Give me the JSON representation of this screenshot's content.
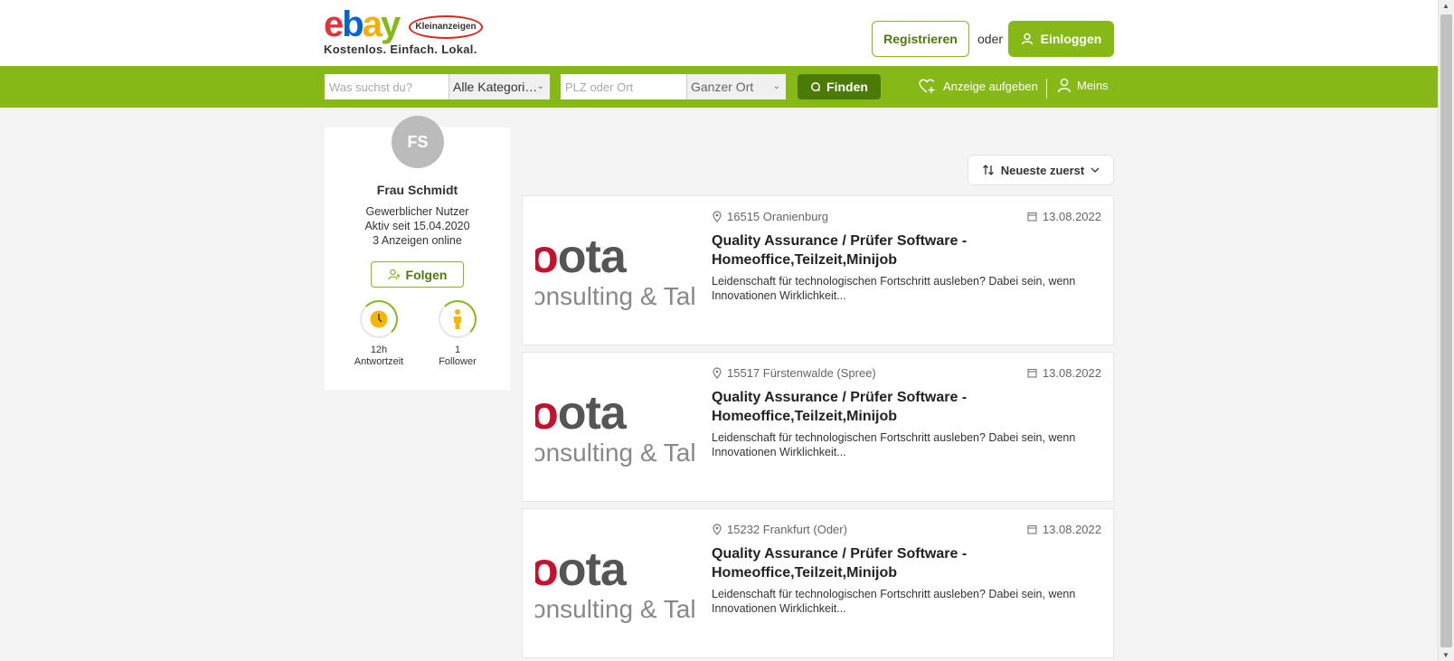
{
  "header": {
    "logo_ebay": "ebay",
    "logo_badge": "Kleinanzeigen",
    "tagline": "Kostenlos. Einfach. Lokal.",
    "register_label": "Registrieren",
    "or_label": "oder",
    "login_label": "Einloggen"
  },
  "search": {
    "query_placeholder": "Was suchst du?",
    "category_value": "Alle Kategori…",
    "location_placeholder": "PLZ oder Ort",
    "radius_value": "Ganzer Ort",
    "find_label": "Finden",
    "post_ad_label": "Anzeige aufgeben",
    "meins_label": "Meins"
  },
  "profile": {
    "initials": "FS",
    "name": "Frau Schmidt",
    "user_type": "Gewerblicher Nutzer",
    "active_since": "Aktiv seit 15.04.2020",
    "ads_online": "3 Anzeigen online",
    "follow_label": "Folgen",
    "stats": [
      {
        "value": "12h",
        "label": "Antwortzeit",
        "icon": "clock-icon"
      },
      {
        "value": "1",
        "label": "Follower",
        "icon": "person-icon"
      }
    ]
  },
  "sort": {
    "label": "Neueste zuerst"
  },
  "listings": [
    {
      "location": "16515 Oranienburg",
      "date": "13.08.2022",
      "title": "Quality Assurance / Prüfer Software - Homeoffice,Teilzeit,Minijob",
      "description": "Leidenschaft für technologischen Fortschritt ausleben? Dabei sein, wenn Innovationen Wirklichkeit...",
      "image_text_main": "ota",
      "image_text_sub": "onsulting & Tale"
    },
    {
      "location": "15517 Fürstenwalde (Spree)",
      "date": "13.08.2022",
      "title": "Quality Assurance / Prüfer Software - Homeoffice,Teilzeit,Minijob",
      "description": "Leidenschaft für technologischen Fortschritt ausleben? Dabei sein, wenn Innovationen Wirklichkeit...",
      "image_text_main": "ota",
      "image_text_sub": "onsulting & Tale"
    },
    {
      "location": "15232 Frankfurt (Oder)",
      "date": "13.08.2022",
      "title": "Quality Assurance / Prüfer Software - Homeoffice,Teilzeit,Minijob",
      "description": "Leidenschaft für technologischen Fortschritt ausleben? Dabei sein, wenn Innovationen Wirklichkeit...",
      "image_text_main": "ota",
      "image_text_sub": "onsulting & Tale"
    }
  ],
  "colors": {
    "brand_green": "#86b817",
    "dark_green": "#4b7a06",
    "background": "#f4f4f4"
  }
}
